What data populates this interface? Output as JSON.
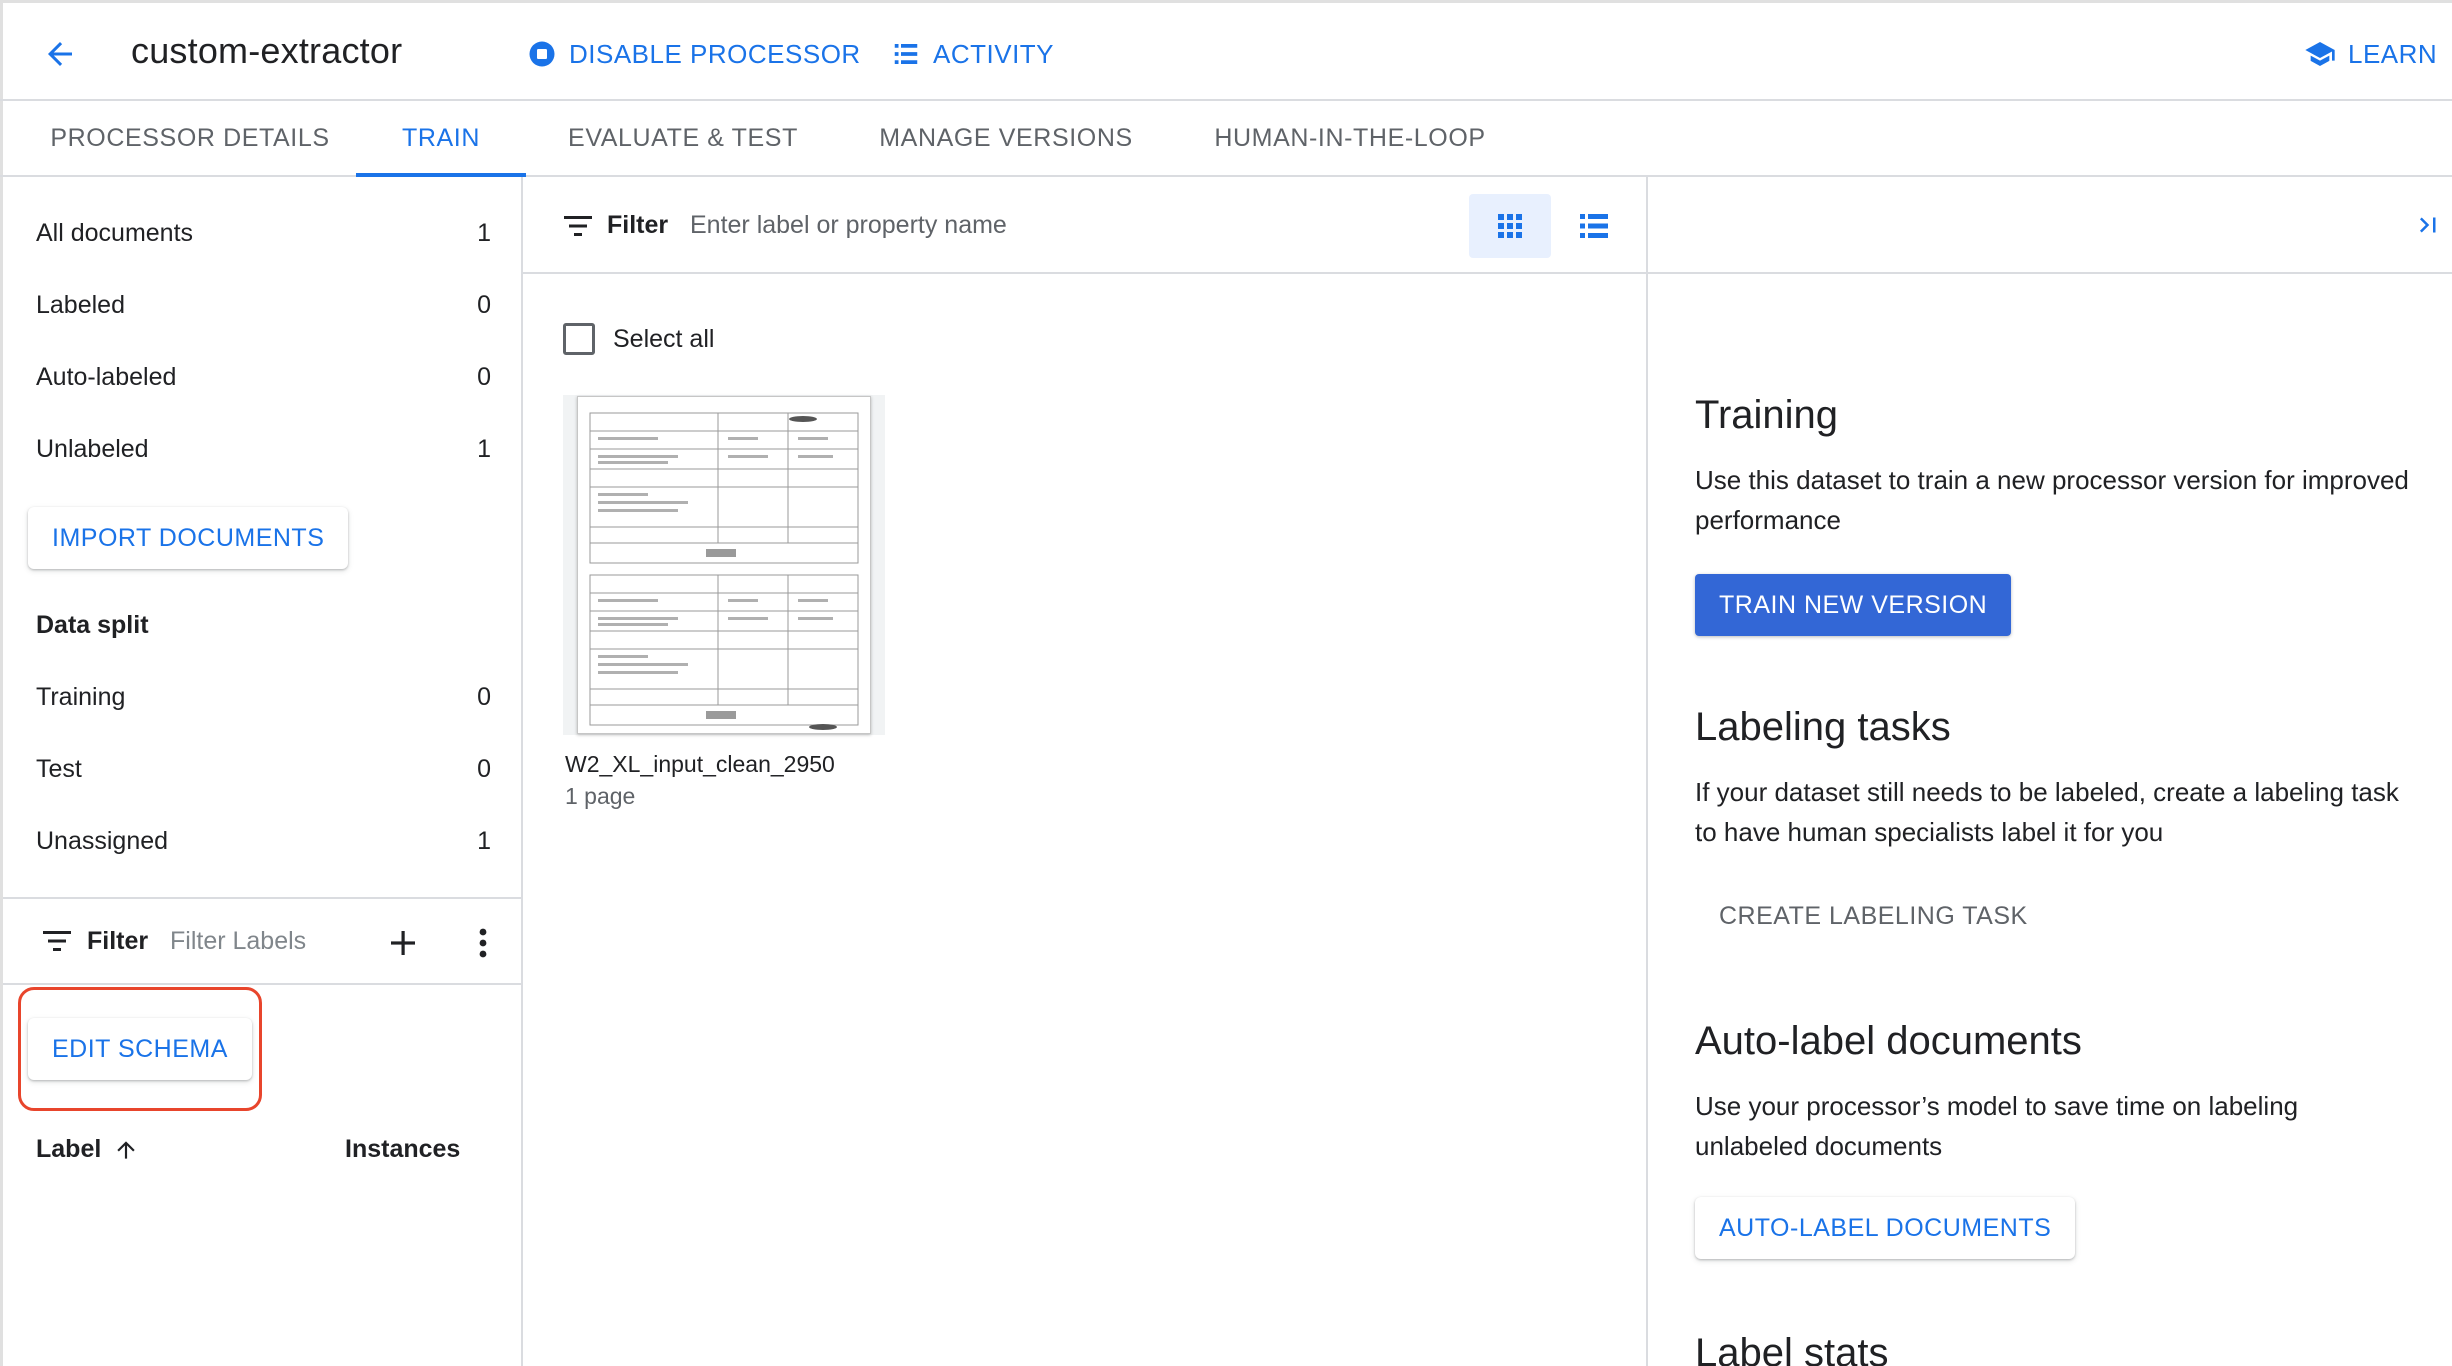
{
  "header": {
    "title": "custom-extractor",
    "disable_label": "DISABLE PROCESSOR",
    "activity_label": "ACTIVITY",
    "learn_label": "LEARN"
  },
  "tabs": [
    {
      "label": "PROCESSOR DETAILS"
    },
    {
      "label": "TRAIN"
    },
    {
      "label": "EVALUATE & TEST"
    },
    {
      "label": "MANAGE VERSIONS"
    },
    {
      "label": "HUMAN-IN-THE-LOOP"
    }
  ],
  "active_tab": "TRAIN",
  "sidebar": {
    "counts": [
      {
        "label": "All documents",
        "value": "1"
      },
      {
        "label": "Labeled",
        "value": "0"
      },
      {
        "label": "Auto-labeled",
        "value": "0"
      },
      {
        "label": "Unlabeled",
        "value": "1"
      }
    ],
    "import_label": "IMPORT DOCUMENTS",
    "data_split_title": "Data split",
    "split": [
      {
        "label": "Training",
        "value": "0"
      },
      {
        "label": "Test",
        "value": "0"
      },
      {
        "label": "Unassigned",
        "value": "1"
      }
    ],
    "filter_label": "Filter",
    "filter_placeholder": "Filter Labels",
    "edit_schema_label": "EDIT SCHEMA",
    "label_column": "Label",
    "instances_column": "Instances"
  },
  "documents": {
    "filter_label": "Filter",
    "filter_placeholder": "Enter label or property name",
    "select_all_label": "Select all",
    "items": [
      {
        "name": "W2_XL_input_clean_2950",
        "pages": "1 page"
      }
    ]
  },
  "panel": {
    "training": {
      "title": "Training",
      "description": "Use this dataset to train a new processor version for improved performance",
      "button": "TRAIN NEW VERSION"
    },
    "labeling": {
      "title": "Labeling tasks",
      "description": "If your dataset still needs to be labeled, create a labeling task to have human specialists label it for you",
      "button": "CREATE LABELING TASK"
    },
    "auto_label": {
      "title": "Auto-label documents",
      "description": "Use your processor’s model to save time on labeling unlabeled documents",
      "button": "AUTO-LABEL DOCUMENTS"
    },
    "label_stats": {
      "title": "Label stats"
    }
  },
  "colors": {
    "accent": "#1a73e8",
    "primary_button": "#3367d6",
    "highlight": "#e8452c"
  }
}
